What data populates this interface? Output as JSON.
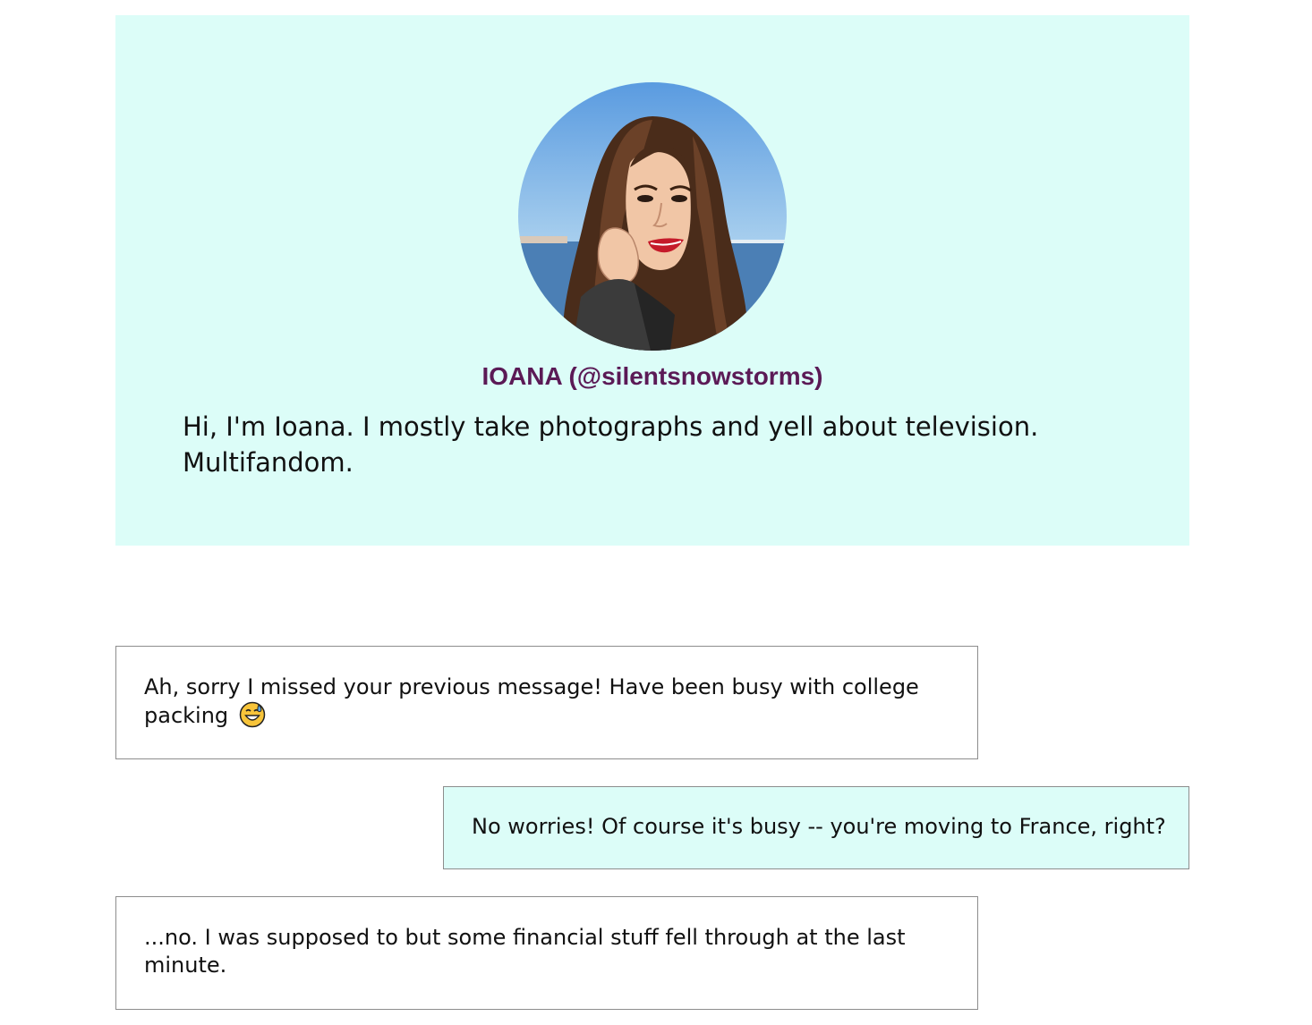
{
  "profile": {
    "name": "IOANA (@silentsnowstorms)",
    "bio": "Hi, I'm Ioana. I mostly take photographs and yell about television. Multifandom."
  },
  "messages": [
    {
      "side": "incoming",
      "text": "Ah, sorry I missed your previous message! Have been busy with college packing",
      "emoji": "grinning-face-with-sweat-icon"
    },
    {
      "side": "outgoing",
      "text": "No worries! Of course it's busy -- you're moving to France, right?"
    },
    {
      "side": "incoming",
      "text": "...no. I was supposed to but some financial stuff fell through at the last minute."
    }
  ],
  "colors": {
    "card_background": "#dcfdf8",
    "name_color": "#5b1a56",
    "border": "#8d8d8d"
  }
}
